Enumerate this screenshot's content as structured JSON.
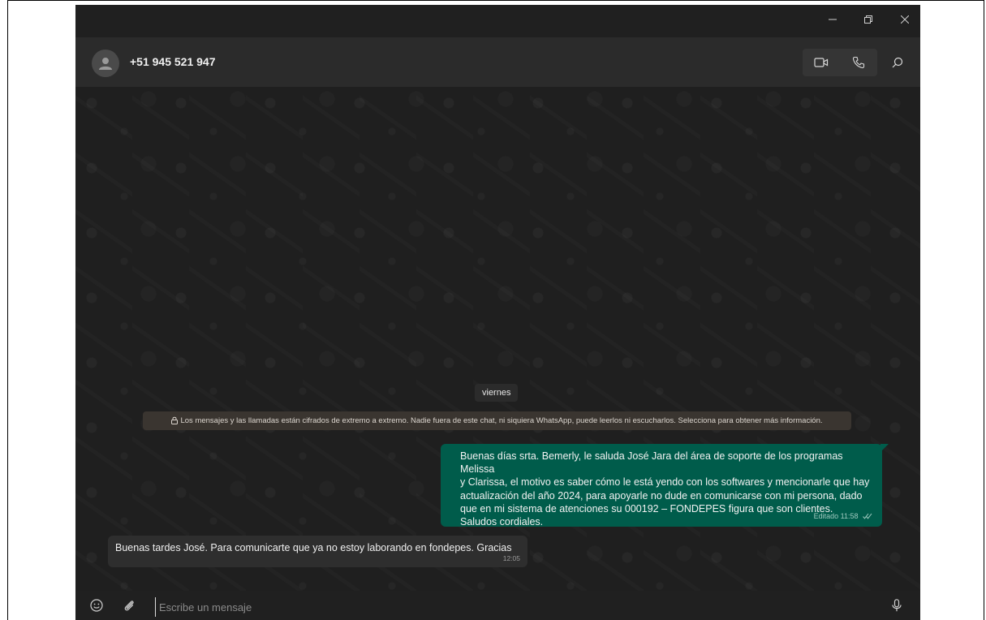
{
  "window": {
    "controls": [
      "minimize",
      "restore",
      "close"
    ]
  },
  "chat_header": {
    "contact_name": "+51 945 521 947",
    "icons": [
      "avatar-icon",
      "video-call-icon",
      "voice-call-icon",
      "search-icon"
    ]
  },
  "conversation": {
    "date_chip": "viernes",
    "encryption_notice": "Los mensajes y las llamadas están cifrados de extremo a extremo. Nadie fuera de este chat, ni siquiera WhatsApp, puede leerlos ni escucharlos. Selecciona para obtener más información.",
    "messages": [
      {
        "direction": "outgoing",
        "lines": [
          "Buenas días srta. Bemerly, le saluda José Jara del área de soporte de los programas Melissa",
          "y Clarissa, el motivo es saber cómo le está yendo con los softwares y mencionarle que hay",
          "actualización del año 2024, para apoyarle no dude en comunicarse con mi persona, dado",
          "que en mi sistema de atenciones su 000192 – FONDEPES figura que son clientes.",
          "Saludos cordiales."
        ],
        "meta": "Editado 11:58",
        "status": "read-double-check"
      },
      {
        "direction": "incoming",
        "text": "Buenas tardes José. Para comunicarte que ya no estoy laborando en fondepes. Gracias",
        "meta": "12:05"
      }
    ]
  },
  "composer": {
    "placeholder": "Escribe un mensaje",
    "icons": [
      "emoji-icon",
      "attach-icon",
      "microphone-icon"
    ]
  },
  "colors": {
    "outgoing_bubble": "#005c4b",
    "incoming_bubble": "#2e2e2e",
    "chat_background": "#1f1f1f",
    "header_background": "#2b2b2b"
  }
}
